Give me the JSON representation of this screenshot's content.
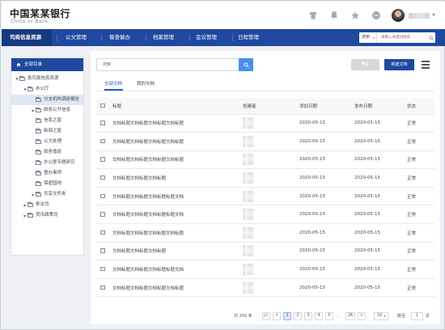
{
  "header": {
    "bank_name_cn": "中国某某银行",
    "bank_name_en": "China xx Bank",
    "icons": [
      "shirt-icon",
      "bell-icon",
      "star-icon",
      "more-icon"
    ]
  },
  "nav": {
    "items": [
      "司局信息资源",
      "公文管理",
      "督查督办",
      "档案管理",
      "会议管理",
      "日程管理"
    ],
    "active_index": 0,
    "search": {
      "scope_value": "搜索",
      "placeholder": "请输入关键词搜索"
    }
  },
  "sidebar": {
    "title": "全部目录",
    "tree": [
      {
        "label": "各司局信息资源",
        "level": 0,
        "expanded": true,
        "arrow": "down"
      },
      {
        "label": "办公厅",
        "level": 1,
        "expanded": true,
        "arrow": "down"
      },
      {
        "label": "分支机构调研报告",
        "level": 2,
        "arrow": "",
        "selected": true
      },
      {
        "label": "政务公开信息",
        "level": 2,
        "arrow": "right"
      },
      {
        "label": "信息之窗",
        "level": 2,
        "arrow": ""
      },
      {
        "label": "新闻之窗",
        "level": 2,
        "arrow": ""
      },
      {
        "label": "公文处理",
        "level": 2,
        "arrow": ""
      },
      {
        "label": "政务值班",
        "level": 2,
        "arrow": ""
      },
      {
        "label": "办公室专题研究",
        "level": 2,
        "arrow": ""
      },
      {
        "label": "督办事项",
        "level": 2,
        "arrow": ""
      },
      {
        "label": "保密园地",
        "level": 2,
        "arrow": ""
      },
      {
        "label": "共享文件夹",
        "level": 2,
        "arrow": "right"
      },
      {
        "label": "条法司",
        "level": 1,
        "arrow": "right"
      },
      {
        "label": "货币政策司",
        "level": 1,
        "arrow": "right"
      }
    ]
  },
  "toolbar": {
    "search_placeholder": "搜索",
    "delete_label": "删除",
    "new_label": "新建文档"
  },
  "tabs": [
    "全部文档",
    "我的文档"
  ],
  "table": {
    "columns": [
      "标题",
      "创建者",
      "添加日期",
      "发布日期",
      "状态"
    ],
    "rows": [
      {
        "title": "文档标题文档标题文档标题文档标题",
        "added": "2020-05-15",
        "published": "2020-05-15",
        "status": "正常"
      },
      {
        "title": "文档标题文档标题文档标题文档标题",
        "added": "2020-05-15",
        "published": "2020-05-15",
        "status": "正常"
      },
      {
        "title": "文档标题文档标题文档标题文档标题",
        "added": "2020-05-15",
        "published": "2020-05-15",
        "status": "正常"
      },
      {
        "title": "文档标题文档标题文档标题",
        "added": "2020-05-15",
        "published": "2020-05-15",
        "status": "正常"
      },
      {
        "title": "文档标题文档标题文档标题标题文档",
        "added": "2020-05-15",
        "published": "2020-05-15",
        "status": "正常"
      },
      {
        "title": "文档标题文档标题文档标题标题文档",
        "added": "2020-05-15",
        "published": "2020-05-15",
        "status": "正常"
      },
      {
        "title": "文档标题文档标题文档标题文档标题",
        "added": "2020-05-15",
        "published": "2020-05-15",
        "status": "正常"
      },
      {
        "title": "文档标题文档标题文档标题",
        "added": "2020-05-15",
        "published": "2020-05-15",
        "status": "正常"
      },
      {
        "title": "文档标题文档标题文档标题标题文档",
        "added": "2020-05-15",
        "published": "2020-05-15",
        "status": "正常"
      },
      {
        "title": "文档标题文档标题文档标题文档标题",
        "added": "2020-05-15",
        "published": "2020-05-15",
        "status": "正常"
      }
    ]
  },
  "pagination": {
    "total_text": "共 256 条",
    "first": "|<",
    "prev": "<",
    "pages": [
      "1",
      "2",
      "3",
      "4",
      "5"
    ],
    "current": "1",
    "dots": "...",
    "last_page": "26",
    "next": ">",
    "end": ">|",
    "page_size": "10",
    "jump_label": "跳至",
    "jump_value": "1",
    "page_unit": "页"
  },
  "colors": {
    "brand": "#1f48a0",
    "nav_active": "#16397f",
    "accent_blue": "#4a8ef0",
    "selected_bg": "#dfe7f6"
  }
}
